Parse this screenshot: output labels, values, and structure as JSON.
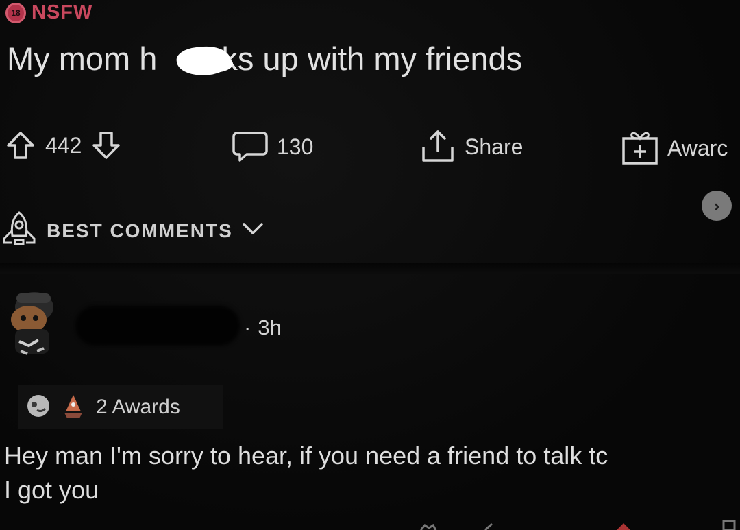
{
  "post": {
    "nsfw_badge": "18",
    "nsfw_label": "NSFW",
    "title": "My mom h  ks up with my friends",
    "upvotes": "442",
    "comment_count": "130",
    "share_label": "Share",
    "award_label": "Awarc"
  },
  "sort": {
    "label": "BEST COMMENTS"
  },
  "comment": {
    "time": "3h",
    "awards_label": "2 Awards",
    "body_line1": "Hey man I'm sorry to hear, if you need a friend to talk tc",
    "body_line2": "I got you"
  },
  "icons": {
    "upvote": "arrow-up-outline-icon",
    "downvote": "arrow-down-outline-icon",
    "comment": "speech-bubble-icon",
    "share": "share-upload-icon",
    "award": "gift-plus-icon",
    "sort": "rocket-icon",
    "chevron": "chevron-down-icon",
    "next": "chevron-right-icon"
  },
  "colors": {
    "background": "#070707",
    "nsfw": "#c9485e",
    "text": "#dedede"
  }
}
